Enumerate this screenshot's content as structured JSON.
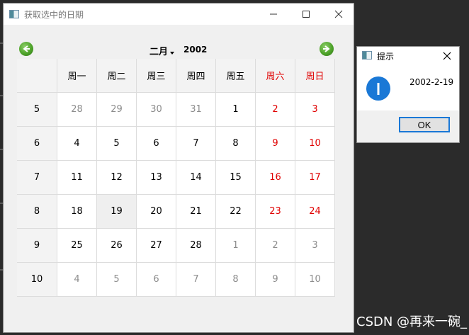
{
  "main_window": {
    "title": "获取选中的日期",
    "calendar": {
      "month": "二月",
      "year": "2002",
      "weekday_headers": [
        "周一",
        "周二",
        "周三",
        "周四",
        "周五",
        "周六",
        "周日"
      ],
      "weeks": [
        {
          "week": "5",
          "days": [
            "28",
            "29",
            "30",
            "31",
            "1",
            "2",
            "3"
          ]
        },
        {
          "week": "6",
          "days": [
            "4",
            "5",
            "6",
            "7",
            "8",
            "9",
            "10"
          ]
        },
        {
          "week": "7",
          "days": [
            "11",
            "12",
            "13",
            "14",
            "15",
            "16",
            "17"
          ]
        },
        {
          "week": "8",
          "days": [
            "18",
            "19",
            "20",
            "21",
            "22",
            "23",
            "24"
          ]
        },
        {
          "week": "9",
          "days": [
            "25",
            "26",
            "27",
            "28",
            "1",
            "2",
            "3"
          ]
        },
        {
          "week": "10",
          "days": [
            "4",
            "5",
            "6",
            "7",
            "8",
            "9",
            "10"
          ]
        }
      ],
      "selected_day": "19"
    }
  },
  "message_box": {
    "title": "提示",
    "text": "2002-2-19",
    "ok_label": "OK"
  },
  "watermark": "CSDN @再来一碗_",
  "colors": {
    "weekend": "#e00000",
    "other_month": "#8c8c8c",
    "accent": "#1a78d6",
    "nav_arrow": "#4ea32a"
  }
}
